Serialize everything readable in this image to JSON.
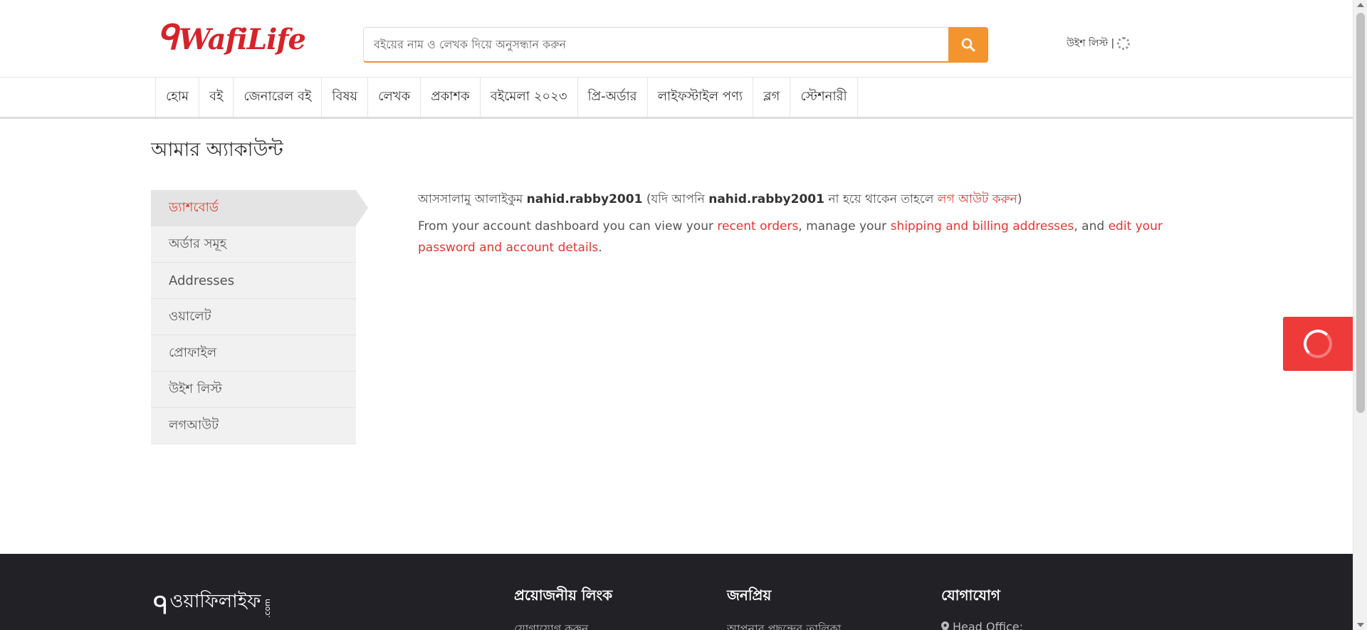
{
  "header": {
    "logo_text": "WafiLife",
    "search_placeholder": "বইয়ের নাম ও লেখক দিয়ে অনুসন্ধান করুন",
    "wishlist_label": "উইশ লিস্ট |"
  },
  "nav": {
    "items": [
      {
        "label": "হোম"
      },
      {
        "label": "বই"
      },
      {
        "label": "জেনারেল বই"
      },
      {
        "label": "বিষয়"
      },
      {
        "label": "লেখক"
      },
      {
        "label": "প্রকাশক"
      },
      {
        "label": "বইমেলা ২০২৩"
      },
      {
        "label": "প্রি-অর্ডার"
      },
      {
        "label": "লাইফস্টাইল পণ্য"
      },
      {
        "label": "ব্লগ"
      },
      {
        "label": "স্টেশনারী"
      }
    ]
  },
  "page": {
    "title": "আমার অ্যাকাউন্ট"
  },
  "sidebar": {
    "items": [
      {
        "label": "ড্যাশবোর্ড",
        "active": true
      },
      {
        "label": "অর্ডার সমূহ"
      },
      {
        "label": "Addresses"
      },
      {
        "label": "ওয়ালেট"
      },
      {
        "label": "প্রোফাইল"
      },
      {
        "label": "উইশ লিস্ট"
      },
      {
        "label": "লগআউট"
      }
    ]
  },
  "dashboard": {
    "greeting_prefix": "আসসালামু আলাইকুম",
    "username": "nahid.rabby2001",
    "greeting_mid": "(যদি আপনি",
    "username_2": "nahid.rabby2001",
    "greeting_suffix": "না হয়ে থাকেন তাহলে",
    "logout_link": "লগ আউট করুন",
    "close_paren": ")",
    "desc_1": "From your account dashboard you can view your",
    "link_orders": "recent orders",
    "desc_2": ", manage your",
    "link_addresses": "shipping and billing addresses",
    "desc_3": ", and",
    "link_account": "edit your password and account details",
    "desc_4": "."
  },
  "footer": {
    "logo_text": "ওয়াফিলাইফ",
    "logo_suffix": ".com",
    "col1_title": "প্রয়োজনীয় লিংক",
    "col1_link": "যোগাযোগ করুন",
    "col2_title": "জনপ্রিয়",
    "col2_link": "আপনার পছন্দের তালিকা",
    "col3_title": "যোগাযোগ",
    "col3_text": "Head Office:"
  },
  "colors": {
    "brand_red": "#e4362f",
    "search_orange": "#f3942f",
    "footer_bg": "#222126"
  },
  "icons": {
    "search": "search-icon",
    "loading": "loading-spinner-icon",
    "location": "map-marker-icon"
  }
}
